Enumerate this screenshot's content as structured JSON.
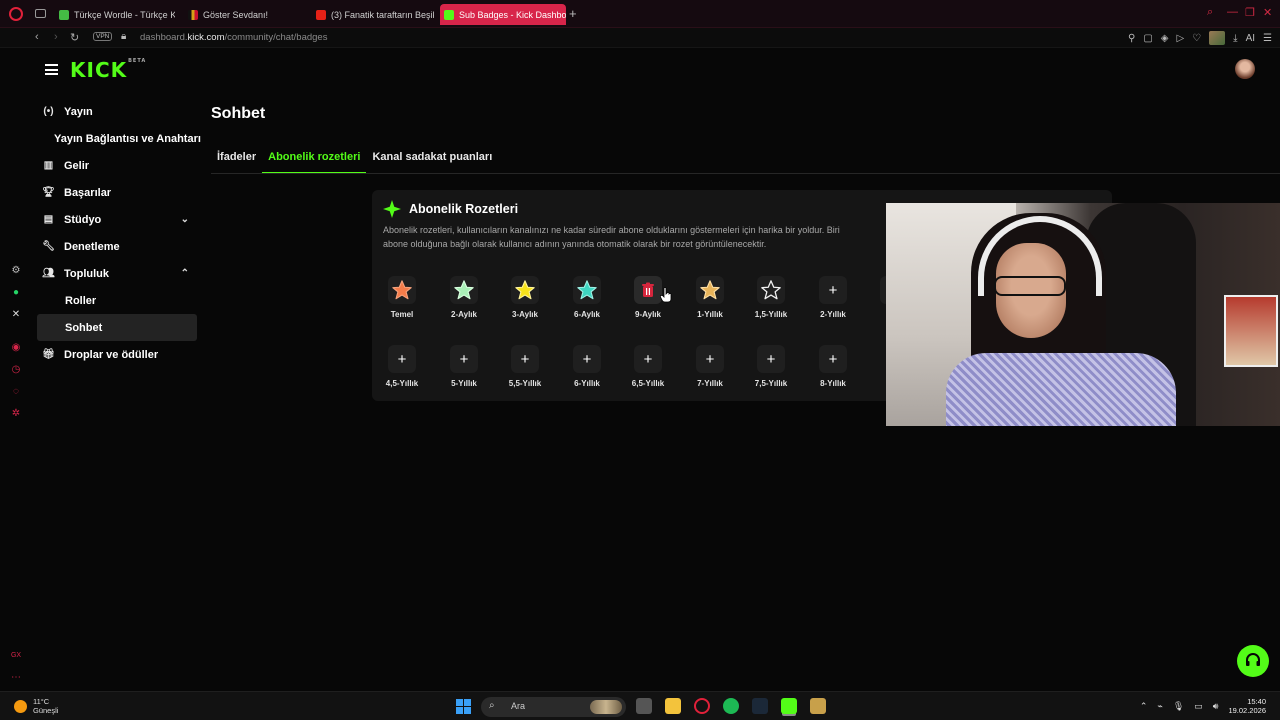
{
  "browser": {
    "tabs": [
      {
        "title": "Türkçe Wordle - Türkçe K",
        "color": "#44bb44"
      },
      {
        "title": "Göster Sevdanı!",
        "color": "#d4a017"
      },
      {
        "title": "(3) Fanatik taraftarın Beşik",
        "color": "#e62117"
      },
      {
        "title": "Sub Badges - Kick Dashbo",
        "color": "#53fc18"
      }
    ],
    "vpn_label": "VPN",
    "url_prefix": "dashboard.",
    "url_domain": "kick.com",
    "url_path": "/community/chat/badges",
    "ai_label": "AI"
  },
  "app": {
    "logo": "KICK",
    "logo_badge": "BETA",
    "accent": "#53fc18"
  },
  "sidebar": {
    "items": [
      {
        "label": "Yayın",
        "icon": "broadcast-icon"
      },
      {
        "label": "Yayın Bağlantısı ve Anahtarı",
        "icon": ""
      },
      {
        "label": "Gelir",
        "icon": "chart-icon"
      },
      {
        "label": "Başarılar",
        "icon": "trophy-icon"
      },
      {
        "label": "Stüdyo",
        "icon": "studio-icon"
      },
      {
        "label": "Denetleme",
        "icon": "wrench-icon"
      },
      {
        "label": "Topluluk",
        "icon": "people-icon"
      },
      {
        "label": "Roller",
        "icon": ""
      },
      {
        "label": "Sohbet",
        "icon": ""
      },
      {
        "label": "Droplar ve ödüller",
        "icon": "gift-icon"
      }
    ]
  },
  "page": {
    "title": "Sohbet",
    "tabs": [
      "İfadeler",
      "Abonelik rozetleri",
      "Kanal sadakat puanları"
    ],
    "active_tab": "Abonelik rozetleri"
  },
  "badges_card": {
    "title": "Abonelik Rozetleri",
    "desc_line1": "Abonelik rozetleri, kullanıcıların kanalınızı ne kadar süredir abone olduklarını göstermeleri için harika bir yoldur. Biri",
    "desc_line2": "abone olduğuna bağlı olarak kullanıcı adının yanında otomatik olarak bir rozet görüntülenecektir.",
    "row1": [
      {
        "label": "Temel",
        "icon": "star-orange",
        "color": "#f47c4a"
      },
      {
        "label": "2-Aylık",
        "icon": "star-mint",
        "color": "#a9f0b7"
      },
      {
        "label": "3-Aylık",
        "icon": "star-yellow",
        "color": "#f7e21a"
      },
      {
        "label": "6-Aylık",
        "icon": "star-teal",
        "color": "#3fd6c1"
      },
      {
        "label": "9-Aylık",
        "icon": "trash-icon",
        "color": "#d7263d"
      },
      {
        "label": "1-Yıllık",
        "icon": "star-gold",
        "color": "#e8b45a"
      },
      {
        "label": "1,5-Yıllık",
        "icon": "star-dark",
        "color": "#222222"
      },
      {
        "label": "2-Yıllık",
        "icon": "plus-icon",
        "color": ""
      },
      {
        "label": "2,",
        "icon": "plus-icon",
        "color": ""
      }
    ],
    "row2": [
      {
        "label": "4,5-Yıllık",
        "icon": "plus-icon"
      },
      {
        "label": "5-Yıllık",
        "icon": "plus-icon"
      },
      {
        "label": "5,5-Yıllık",
        "icon": "plus-icon"
      },
      {
        "label": "6-Yıllık",
        "icon": "plus-icon"
      },
      {
        "label": "6,5-Yıllık",
        "icon": "plus-icon"
      },
      {
        "label": "7-Yıllık",
        "icon": "plus-icon"
      },
      {
        "label": "7,5-Yıllık",
        "icon": "plus-icon"
      },
      {
        "label": "8-Yıllık",
        "icon": "plus-icon"
      }
    ]
  },
  "taskbar": {
    "temp": "11°C",
    "weather": "Güneşli",
    "search": "Ara",
    "time": "15:40",
    "date": "19.02.2026"
  }
}
